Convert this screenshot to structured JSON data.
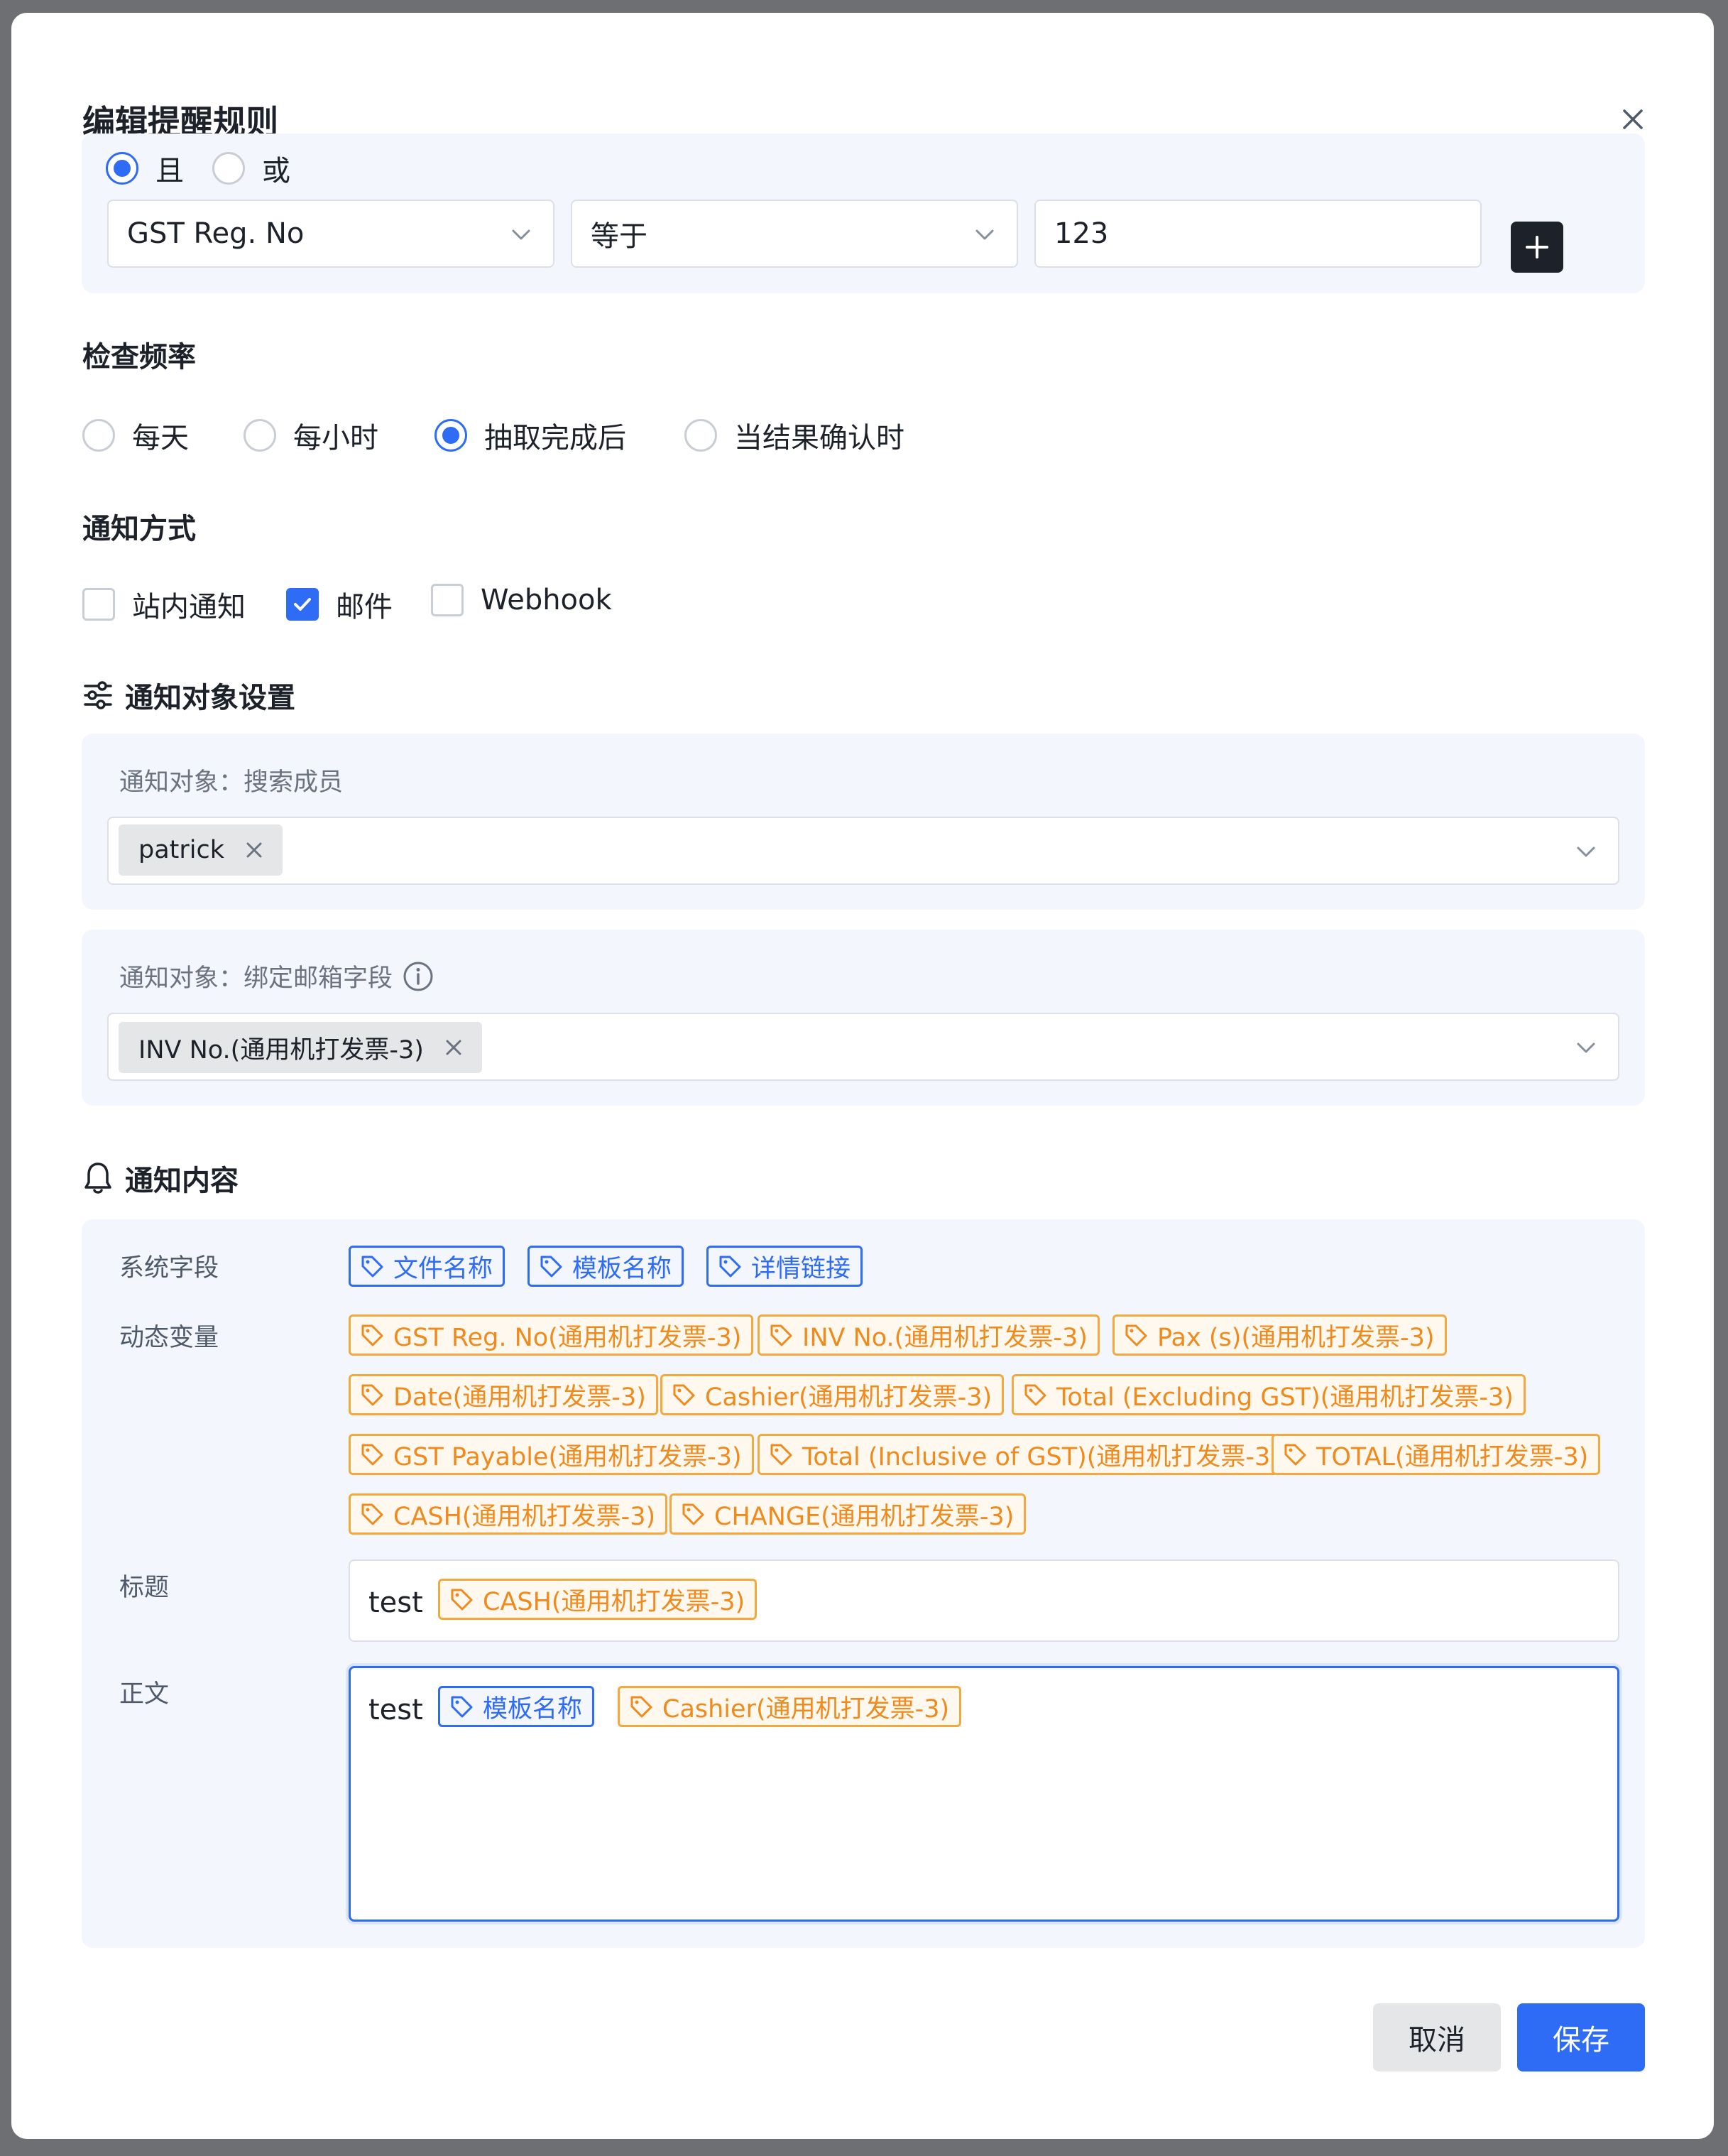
{
  "dialog": {
    "title": "编辑提醒规则"
  },
  "condition": {
    "logic_options": [
      {
        "label": "且",
        "checked": true
      },
      {
        "label": "或",
        "checked": false
      }
    ],
    "field": "GST Reg. No",
    "operator": "等于",
    "value": "123"
  },
  "frequency": {
    "label": "检查频率",
    "options": [
      {
        "label": "每天",
        "checked": false
      },
      {
        "label": "每小时",
        "checked": false
      },
      {
        "label": "抽取完成后",
        "checked": true
      },
      {
        "label": "当结果确认时",
        "checked": false
      }
    ]
  },
  "notify_method": {
    "label": "通知方式",
    "options": [
      {
        "label": "站内通知",
        "checked": false
      },
      {
        "label": "邮件",
        "checked": true
      },
      {
        "label": "Webhook",
        "checked": false
      }
    ]
  },
  "target_settings": {
    "heading": "通知对象设置",
    "members": {
      "label": "通知对象：搜索成员",
      "chips": [
        "patrick"
      ]
    },
    "email_field": {
      "label": "通知对象：绑定邮箱字段",
      "chips": [
        "INV No.(通用机打发票-3)"
      ]
    }
  },
  "content": {
    "heading": "通知内容",
    "system_fields_label": "系统字段",
    "system_fields": [
      "文件名称",
      "模板名称",
      "详情链接"
    ],
    "dynamic_vars_label": "动态变量",
    "dynamic_vars": [
      "GST Reg. No(通用机打发票-3)",
      "INV No.(通用机打发票-3)",
      "Pax (s)(通用机打发票-3)",
      "Date(通用机打发票-3)",
      "Cashier(通用机打发票-3)",
      "Total (Excluding GST)(通用机打发票-3)",
      "GST Payable(通用机打发票-3)",
      "Total (Inclusive of GST)(通用机打发票-3)",
      "TOTAL(通用机打发票-3)",
      "CASH(通用机打发票-3)",
      "CHANGE(通用机打发票-3)"
    ],
    "subject_label": "标题",
    "subject_text": "test",
    "subject_tag": "CASH(通用机打发票-3)",
    "body_label": "正文",
    "body_text": "test",
    "body_tags": [
      {
        "label": "模板名称",
        "kind": "system"
      },
      {
        "label": "Cashier(通用机打发票-3)",
        "kind": "dynamic"
      }
    ]
  },
  "footer": {
    "cancel": "取消",
    "save": "保存"
  },
  "colors": {
    "primary": "#2e6cf6",
    "tag_orange": "#f08a1c",
    "panel_bg": "#f3f6fc"
  }
}
